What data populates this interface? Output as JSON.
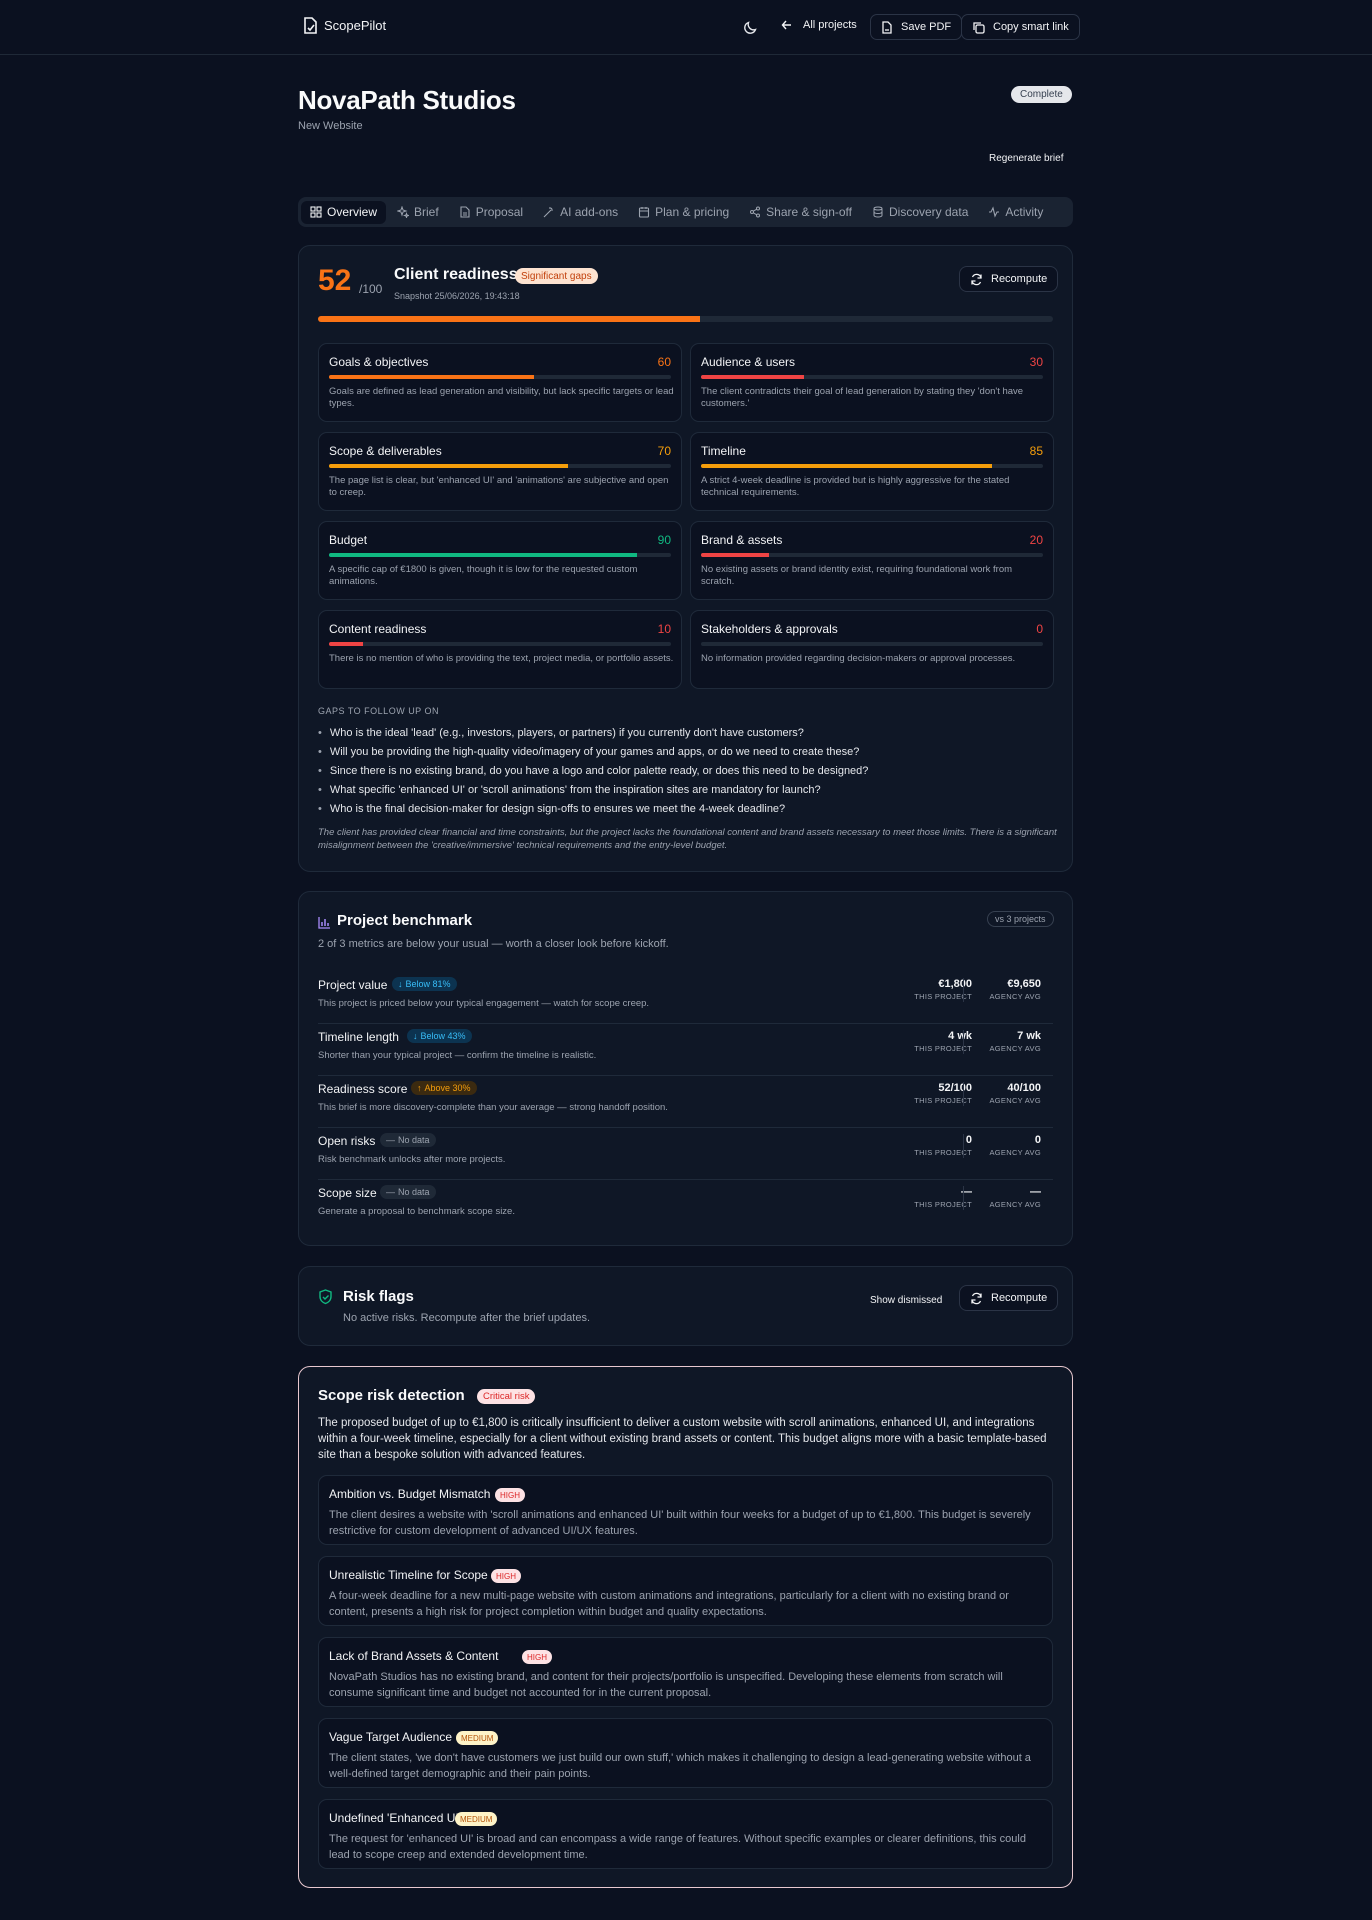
{
  "topbar": {
    "brand": "ScopePilot",
    "all_projects": "All projects",
    "save_pdf": "Save PDF",
    "copy_link": "Copy smart link"
  },
  "project": {
    "name": "NovaPath Studios",
    "type": "New Website",
    "status": "Complete",
    "regenerate": "Regenerate brief"
  },
  "tabs": [
    {
      "label": "Overview",
      "icon": "grid-icon"
    },
    {
      "label": "Brief",
      "icon": "sparkles-icon"
    },
    {
      "label": "Proposal",
      "icon": "document-icon"
    },
    {
      "label": "AI add-ons",
      "icon": "wand-icon"
    },
    {
      "label": "Plan & pricing",
      "icon": "calendar-icon"
    },
    {
      "label": "Share & sign-off",
      "icon": "share-icon"
    },
    {
      "label": "Discovery data",
      "icon": "database-icon"
    },
    {
      "label": "Activity",
      "icon": "activity-icon"
    }
  ],
  "readiness": {
    "score": "52",
    "denominator": "/100",
    "score_value": 52,
    "title": "Client readiness",
    "badge": "Significant gaps",
    "snapshot": "Snapshot 25/06/2026, 19:43:18",
    "recompute": "Recompute",
    "categories": [
      {
        "name": "Goals & objectives",
        "score": "60",
        "value": 60,
        "color": "#f97316",
        "desc": "Goals are defined as lead generation and visibility, but lack specific targets or lead types."
      },
      {
        "name": "Audience & users",
        "score": "30",
        "value": 30,
        "color": "#ef4444",
        "desc": "The client contradicts their goal of lead generation by stating they 'don't have customers.'"
      },
      {
        "name": "Scope & deliverables",
        "score": "70",
        "value": 70,
        "color": "#f59e0b",
        "desc": "The page list is clear, but 'enhanced UI' and 'animations' are subjective and open to creep."
      },
      {
        "name": "Timeline",
        "score": "85",
        "value": 85,
        "color": "#f59e0b",
        "desc": "A strict 4-week deadline is provided but is highly aggressive for the stated technical requirements."
      },
      {
        "name": "Budget",
        "score": "90",
        "value": 90,
        "color": "#10b981",
        "desc": "A specific cap of €1800 is given, though it is low for the requested custom animations."
      },
      {
        "name": "Brand & assets",
        "score": "20",
        "value": 20,
        "color": "#ef4444",
        "desc": "No existing assets or brand identity exist, requiring foundational work from scratch."
      },
      {
        "name": "Content readiness",
        "score": "10",
        "value": 10,
        "color": "#ef4444",
        "desc": "There is no mention of who is providing the text, project media, or portfolio assets."
      },
      {
        "name": "Stakeholders & approvals",
        "score": "0",
        "value": 0,
        "color": "#ef4444",
        "desc": "No information provided regarding decision-makers or approval processes."
      }
    ],
    "gaps_heading": "GAPS TO FOLLOW UP ON",
    "gaps": [
      "Who is the ideal 'lead' (e.g., investors, players, or partners) if you currently don't have customers?",
      "Will you be providing the high-quality video/imagery of your games and apps, or do we need to create these?",
      "Since there is no existing brand, do you have a logo and color palette ready, or does this need to be designed?",
      "What specific 'enhanced UI' or 'scroll animations' from the inspiration sites are mandatory for launch?",
      "Who is the final decision-maker for design sign-offs to ensures we meet the 4-week deadline?"
    ],
    "summary": "The client has provided clear financial and time constraints, but the project lacks the foundational content and brand assets necessary to meet those limits. There is a significant misalignment between the 'creative/immersive' technical requirements and the entry-level budget."
  },
  "benchmark": {
    "title": "Project benchmark",
    "vs": "vs 3 projects",
    "subtitle": "2 of 3 metrics are below your usual — worth a closer look before kickoff.",
    "this_label": "THIS PROJECT",
    "avg_label": "AGENCY AVG",
    "rows": [
      {
        "name": "Project value",
        "pill": "Below 81%",
        "pill_type": "below",
        "pill_icon": "↓",
        "desc": "This project is priced below your typical engagement — watch for scope creep.",
        "this": "€1,800",
        "avg": "€9,650"
      },
      {
        "name": "Timeline length",
        "pill": "Below 43%",
        "pill_type": "below",
        "pill_icon": "↓",
        "desc": "Shorter than your typical project — confirm the timeline is realistic.",
        "this": "4 wk",
        "avg": "7 wk"
      },
      {
        "name": "Readiness score",
        "pill": "Above 30%",
        "pill_type": "above",
        "pill_icon": "↑",
        "desc": "This brief is more discovery-complete than your average — strong handoff position.",
        "this": "52/100",
        "avg": "40/100"
      },
      {
        "name": "Open risks",
        "pill": "No data",
        "pill_type": "nodata",
        "pill_icon": "—",
        "desc": "Risk benchmark unlocks after more projects.",
        "this": "0",
        "avg": "0"
      },
      {
        "name": "Scope size",
        "pill": "No data",
        "pill_type": "nodata",
        "pill_icon": "—",
        "desc": "Generate a proposal to benchmark scope size.",
        "this": "—",
        "avg": "—"
      }
    ]
  },
  "risk_flags": {
    "title": "Risk flags",
    "subtitle": "No active risks. Recompute after the brief updates.",
    "show_dismissed": "Show dismissed",
    "recompute": "Recompute"
  },
  "scope_risk": {
    "title": "Scope risk detection",
    "badge": "Critical risk",
    "desc": "The proposed budget of up to €1,800 is critically insufficient to deliver a custom website with scroll animations, enhanced UI, and integrations within a four-week timeline, especially for a client without existing brand assets or content. This budget aligns more with a basic template-based site than a bespoke solution with advanced features.",
    "items": [
      {
        "title": "Ambition vs. Budget Mismatch",
        "level": "HIGH",
        "level_type": "high",
        "desc": "The client desires a website with 'scroll animations and enhanced UI' built within four weeks for a budget of up to €1,800. This budget is severely restrictive for custom development of advanced UI/UX features."
      },
      {
        "title": "Unrealistic Timeline for Scope",
        "level": "HIGH",
        "level_type": "high",
        "desc": "A four-week deadline for a new multi-page website with custom animations and integrations, particularly for a client with no existing brand or content, presents a high risk for project completion within budget and quality expectations."
      },
      {
        "title": "Lack of Brand Assets & Content",
        "level": "HIGH",
        "level_type": "high",
        "desc": "NovaPath Studios has no existing brand, and content for their projects/portfolio is unspecified. Developing these elements from scratch will consume significant time and budget not accounted for in the current proposal."
      },
      {
        "title": "Vague Target Audience",
        "level": "MEDIUM",
        "level_type": "medium",
        "desc": "The client states, 'we don't have customers we just build our own stuff,' which makes it challenging to design a lead-generating website without a well-defined target demographic and their pain points."
      },
      {
        "title": "Undefined 'Enhanced UI'",
        "level": "MEDIUM",
        "level_type": "medium",
        "desc": "The request for 'enhanced UI' is broad and can encompass a wide range of features. Without specific examples or clearer definitions, this could lead to scope creep and extended development time."
      }
    ]
  }
}
